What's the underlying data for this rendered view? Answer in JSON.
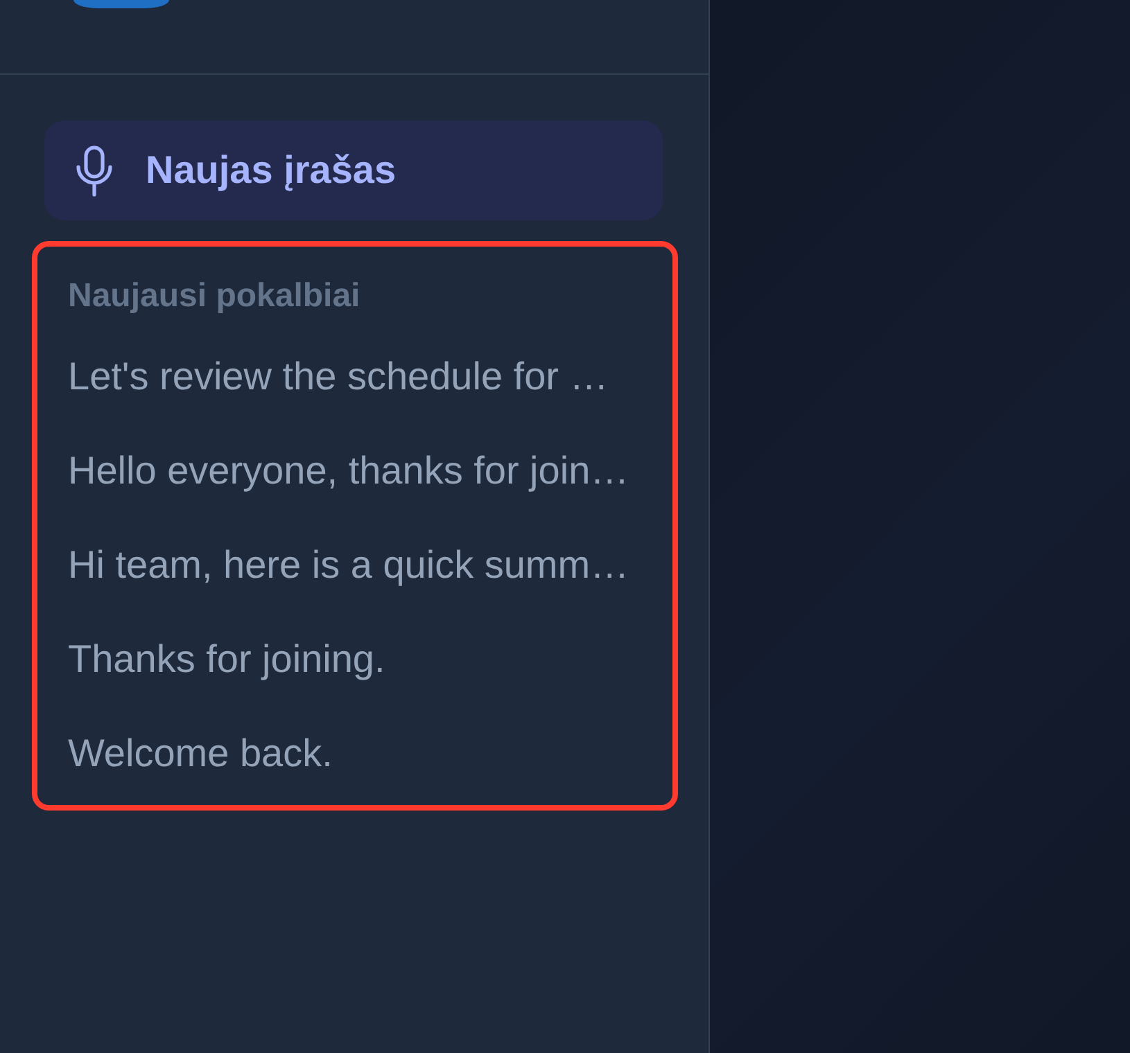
{
  "sidebar": {
    "new_recording_button": {
      "label": "Naujas įrašas"
    },
    "recent_conversations": {
      "highlighted": true,
      "heading": "Naujausi pokalbiai",
      "items": [
        "Let's review the schedule for …",
        "Hello everyone, thanks for join…",
        "Hi team, here is a quick summ…",
        "Thanks for joining.",
        "Welcome back."
      ]
    }
  }
}
